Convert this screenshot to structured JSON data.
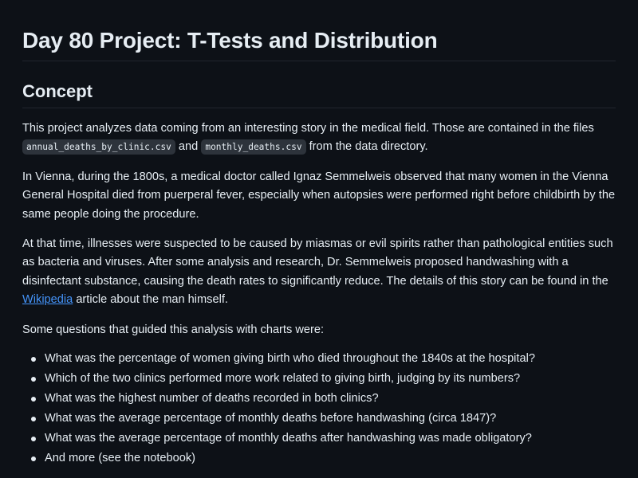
{
  "title": "Day 80 Project: T-Tests and Distribution",
  "section_heading": "Concept",
  "paragraph1": {
    "text_before": "This project analyzes data coming from an interesting story in the medical field. Those are contained in the files ",
    "file1": "annual_deaths_by_clinic.csv",
    "text_middle": " and ",
    "file2": "monthly_deaths.csv",
    "text_after": " from the data directory."
  },
  "paragraph2": "In Vienna, during the 1800s, a medical doctor called Ignaz Semmelweis observed that many women in the Vienna General Hospital died from puerperal fever, especially when autopsies were performed right before childbirth by the same people doing the procedure.",
  "paragraph3": {
    "text_before": "At that time, illnesses were suspected to be caused by miasmas or evil spirits rather than pathological entities such as bacteria and viruses. After some analysis and research, Dr. Semmelweis proposed handwashing with a disinfectant substance, causing the death rates to significantly reduce. The details of this story can be found in the ",
    "link_text": "Wikipedia",
    "text_after": " article about the man himself."
  },
  "paragraph4": "Some questions that guided this analysis with charts were:",
  "questions": [
    "What was the percentage of women giving birth who died throughout the 1840s at the hospital?",
    "Which of the two clinics performed more work related to giving birth, judging by its numbers?",
    "What was the highest number of deaths recorded in both clinics?",
    "What was the average percentage of monthly deaths before handwashing (circa 1847)?",
    "What was the average percentage of monthly deaths after handwashing was made obligatory?",
    "And more (see the notebook)"
  ],
  "colors": {
    "background": "#0d1117",
    "text": "#e6edf3",
    "link": "#4493f8",
    "code_bg": "#2d333b",
    "divider": "#21262d"
  }
}
